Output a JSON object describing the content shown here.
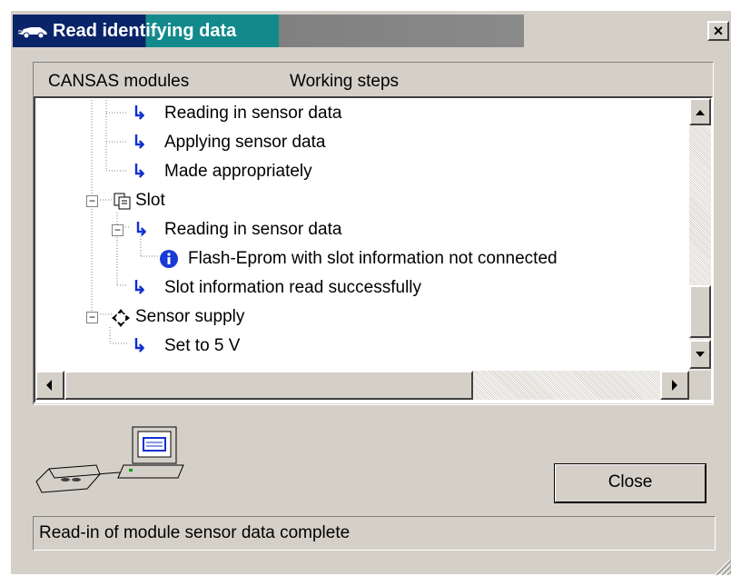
{
  "window": {
    "title": "Read identifying data",
    "close_glyph": "×"
  },
  "columns": {
    "modules": "CANSAS modules",
    "steps": "Working steps"
  },
  "tree": {
    "rows": [
      {
        "label": "Reading in sensor data",
        "icon": "arrow-step-icon"
      },
      {
        "label": "Applying sensor data",
        "icon": "arrow-step-icon"
      },
      {
        "label": "Made appropriately",
        "icon": "arrow-step-icon"
      },
      {
        "label": "Slot",
        "icon": "slot-icon",
        "toggle": "−"
      },
      {
        "label": "Reading in sensor data",
        "icon": "arrow-step-icon",
        "toggle": "−"
      },
      {
        "label": "Flash-Eprom with slot information not connected",
        "icon": "info-icon"
      },
      {
        "label": "Slot information read successfully",
        "icon": "arrow-step-icon"
      },
      {
        "label": "Sensor supply",
        "icon": "sensor-supply-icon",
        "toggle": "−"
      },
      {
        "label": "Set to 5 V",
        "icon": "arrow-step-icon"
      }
    ]
  },
  "buttons": {
    "close": "Close"
  },
  "status": {
    "text": "Read-in of module sensor data complete"
  },
  "colors": {
    "title_dark": "#0a246a",
    "title_teal": "#128a8c",
    "face": "#d4d0c8",
    "step_arrow": "#1030d0",
    "info": "#1a3ad6"
  }
}
